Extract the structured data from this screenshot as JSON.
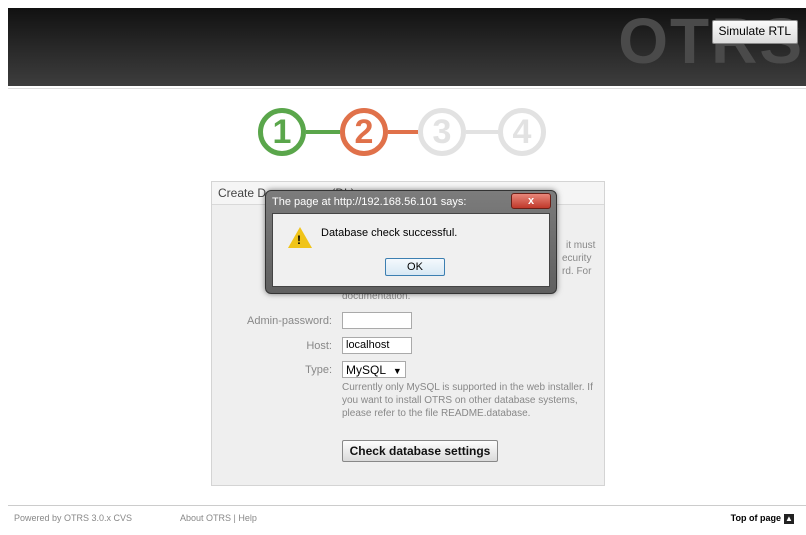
{
  "header": {
    "watermark": "OTRS",
    "simulate_rtl_label": "Simulate RTL"
  },
  "steps": [
    "1",
    "2",
    "3",
    "4"
  ],
  "panel": {
    "title_visible": "Create D",
    "title_tail": "(DL)",
    "hint_fragments": [
      "it must",
      "ecurity",
      "rd. For",
      "documentation."
    ],
    "admin_password_label": "Admin-password:",
    "admin_password_value": "",
    "host_label": "Host:",
    "host_value": "localhost",
    "type_label": "Type:",
    "type_value": "MySQL",
    "type_hint_lines": [
      "Currently only MySQL is supported in the web installer. If",
      "you want to install OTRS on other database systems,",
      "please refer to the file README.database."
    ],
    "check_button_label": "Check database settings"
  },
  "dialog": {
    "title": "The page at http://192.168.56.101 says:",
    "close_label": "x",
    "message": "Database check successful.",
    "ok_label": "OK"
  },
  "footer": {
    "powered_by": "Powered by OTRS 3.0.x CVS",
    "about": "About OTRS",
    "separator": "|",
    "help": "Help",
    "top_of_page": "Top of page"
  },
  "colors": {
    "step_done": "#5aa64b",
    "step_active": "#e0714a",
    "step_todo": "#e2e2e2"
  }
}
